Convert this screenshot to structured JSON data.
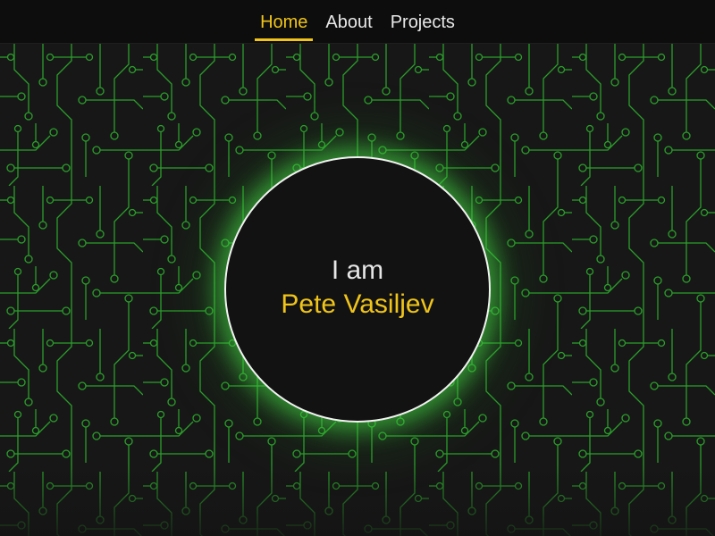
{
  "nav": {
    "items": [
      {
        "label": "Home",
        "active": true
      },
      {
        "label": "About",
        "active": false
      },
      {
        "label": "Projects",
        "active": false
      }
    ]
  },
  "hero": {
    "greeting": "I am",
    "name": "Pete Vasiljev"
  },
  "colors": {
    "accent": "#f0c419",
    "background": "#161616",
    "circuit": "#2fa62f",
    "glow": "#46dc46"
  },
  "background_pattern": "circuit-board"
}
